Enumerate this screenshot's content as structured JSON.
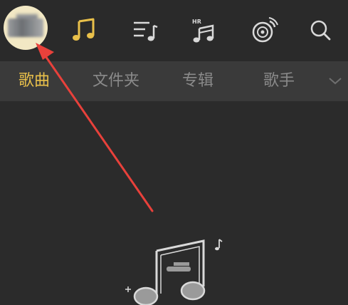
{
  "app": {
    "avatar_icon": "user-avatar-blurred",
    "accent_color": "#e9c04a",
    "background_color": "#2b2b2b"
  },
  "top_icons": [
    {
      "name": "music-note-icon",
      "active": true
    },
    {
      "name": "playlist-icon",
      "active": false
    },
    {
      "name": "hr-music-icon",
      "active": false,
      "badge": "HR"
    },
    {
      "name": "radio-disc-icon",
      "active": false
    },
    {
      "name": "search-icon",
      "active": false
    }
  ],
  "tabs": [
    {
      "label": "歌曲",
      "active": true
    },
    {
      "label": "文件夹",
      "active": false
    },
    {
      "label": "专辑",
      "active": false
    },
    {
      "label": "歌手",
      "active": false
    }
  ],
  "tabs_more_icon": "chevron-down-icon",
  "annotation": {
    "type": "red-arrow",
    "points_to": "avatar"
  },
  "empty_state": {
    "icon": "music-note-empty-icon"
  }
}
